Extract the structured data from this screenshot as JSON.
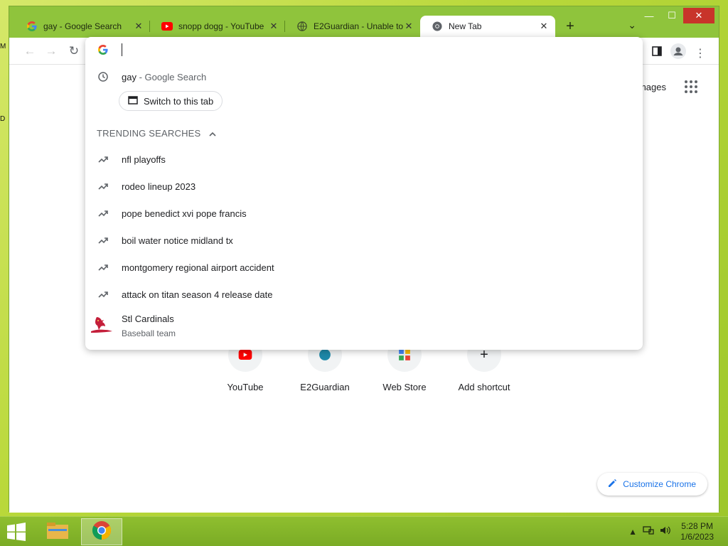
{
  "browser": {
    "tabs": [
      {
        "title": "gay - Google Search",
        "favicon": "google-icon"
      },
      {
        "title": "snopp dogg - YouTube",
        "favicon": "youtube-icon"
      },
      {
        "title": "E2Guardian - Unable to",
        "favicon": "globe-icon"
      },
      {
        "title": "New Tab",
        "favicon": "chrome-icon"
      }
    ],
    "new_tab_glyph": "+",
    "tab_search_glyph": "⌄"
  },
  "newtab": {
    "images_label": "Images",
    "shortcuts": [
      {
        "label": "YouTube"
      },
      {
        "label": "E2Guardian"
      },
      {
        "label": "Web Store"
      },
      {
        "label": "Add shortcut"
      }
    ],
    "customize_label": "Customize Chrome"
  },
  "omnibox": {
    "input_value": "",
    "history": {
      "query": "gay",
      "suffix": " - Google Search",
      "switch_label": "Switch to this tab"
    },
    "trending_heading": "TRENDING SEARCHES",
    "trending": [
      "nfl playoffs",
      "rodeo lineup 2023",
      "pope benedict xvi pope francis",
      "boil water notice midland tx",
      "montgomery regional airport accident",
      "attack on titan season 4 release date"
    ],
    "entity": {
      "title": "Stl Cardinals",
      "subtitle": "Baseball team"
    }
  },
  "taskbar": {
    "time": "5:28 PM",
    "date": "1/6/2023"
  },
  "colors": {
    "accent": "#1a73e8",
    "desktop": "#b9d83a",
    "tab_strip": "#8fc43c"
  }
}
